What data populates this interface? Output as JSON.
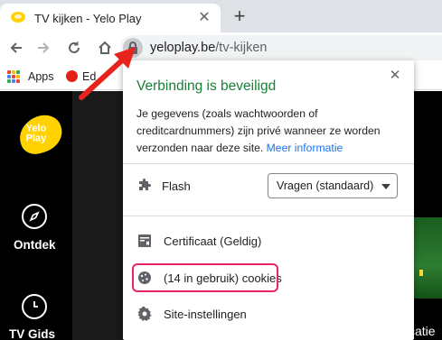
{
  "tab": {
    "title": "TV kijken - Yelo Play",
    "close_icon": "close-icon",
    "new_tab_icon": "plus-icon"
  },
  "toolbar": {
    "back_icon": "arrow-left-icon",
    "forward_icon": "arrow-right-icon",
    "reload_icon": "reload-icon",
    "home_icon": "home-icon",
    "lock_icon": "lock-icon"
  },
  "omnibox": {
    "host": "yeloplay.be",
    "path": "/tv-kijken"
  },
  "bookmarks": {
    "apps_label": "Apps",
    "item_label": "Ed"
  },
  "sidebar": {
    "logo_text": "Yelo\nPlay",
    "items": [
      {
        "label": "Ontdek",
        "icon": "compass-icon"
      },
      {
        "label": "TV Gids",
        "icon": "clock-icon"
      }
    ]
  },
  "video": {
    "caption": "catie"
  },
  "popup": {
    "title": "Verbinding is beveiligd",
    "body": "Je gegevens (zoals wachtwoorden of creditcardnummers) zijn privé wanneer ze worden verzonden naar deze site.",
    "link": "Meer informatie",
    "flash": {
      "label": "Flash",
      "icon": "puzzle-icon",
      "select_value": "Vragen (standaard)"
    },
    "certificate": {
      "label": "Certificaat (Geldig)",
      "icon": "certificate-icon"
    },
    "cookies": {
      "label": "(14 in gebruik) cookies",
      "icon": "cookie-icon"
    },
    "site_settings": {
      "label": "Site-instellingen",
      "icon": "gear-icon"
    }
  },
  "colors": {
    "secure_title": "#188038",
    "link": "#1a73e8",
    "highlight": "#e8246a",
    "annotation_arrow": "#e8231c",
    "brand_yellow": "#ffd200"
  }
}
